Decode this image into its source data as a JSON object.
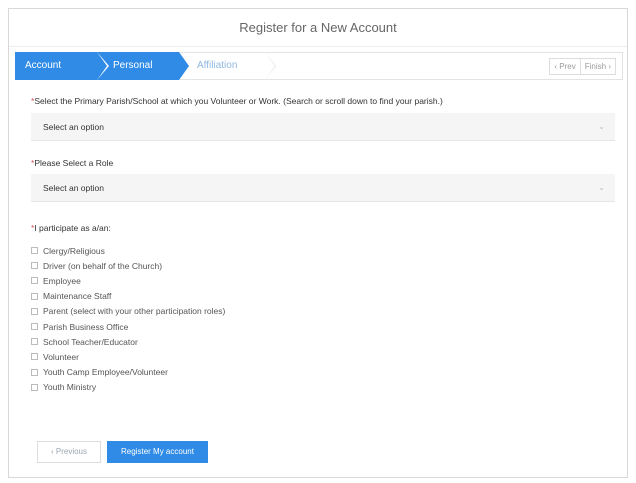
{
  "page": {
    "title": "Register for a New Account"
  },
  "steps": [
    {
      "label": "Account"
    },
    {
      "label": "Personal"
    },
    {
      "label": "Affiliation"
    }
  ],
  "pager": {
    "prev_label": "‹ Prev",
    "finish_label": "Finish ›"
  },
  "parish_field": {
    "label": "Select the Primary Parish/School at which you Volunteer or Work. (Search or scroll down to find your parish.)",
    "required_mark": "*",
    "value": "Select an option",
    "caret": "⌄"
  },
  "role_field": {
    "label": "Please Select a Role",
    "required_mark": "*",
    "value": "Select an option",
    "caret": "⌄"
  },
  "participate": {
    "label": "I participate as a/an:",
    "required_mark": "*",
    "options": [
      "Clergy/Religious",
      "Driver (on behalf of the Church)",
      "Employee",
      "Maintenance Staff",
      "Parent (select with your other participation roles)",
      "Parish Business Office",
      "School Teacher/Educator",
      "Volunteer",
      "Youth Camp Employee/Volunteer",
      "Youth Ministry"
    ]
  },
  "buttons": {
    "previous": "‹ Previous",
    "register": "Register My account"
  },
  "colors": {
    "accent": "#2f8be6",
    "required": "#d9534f"
  }
}
